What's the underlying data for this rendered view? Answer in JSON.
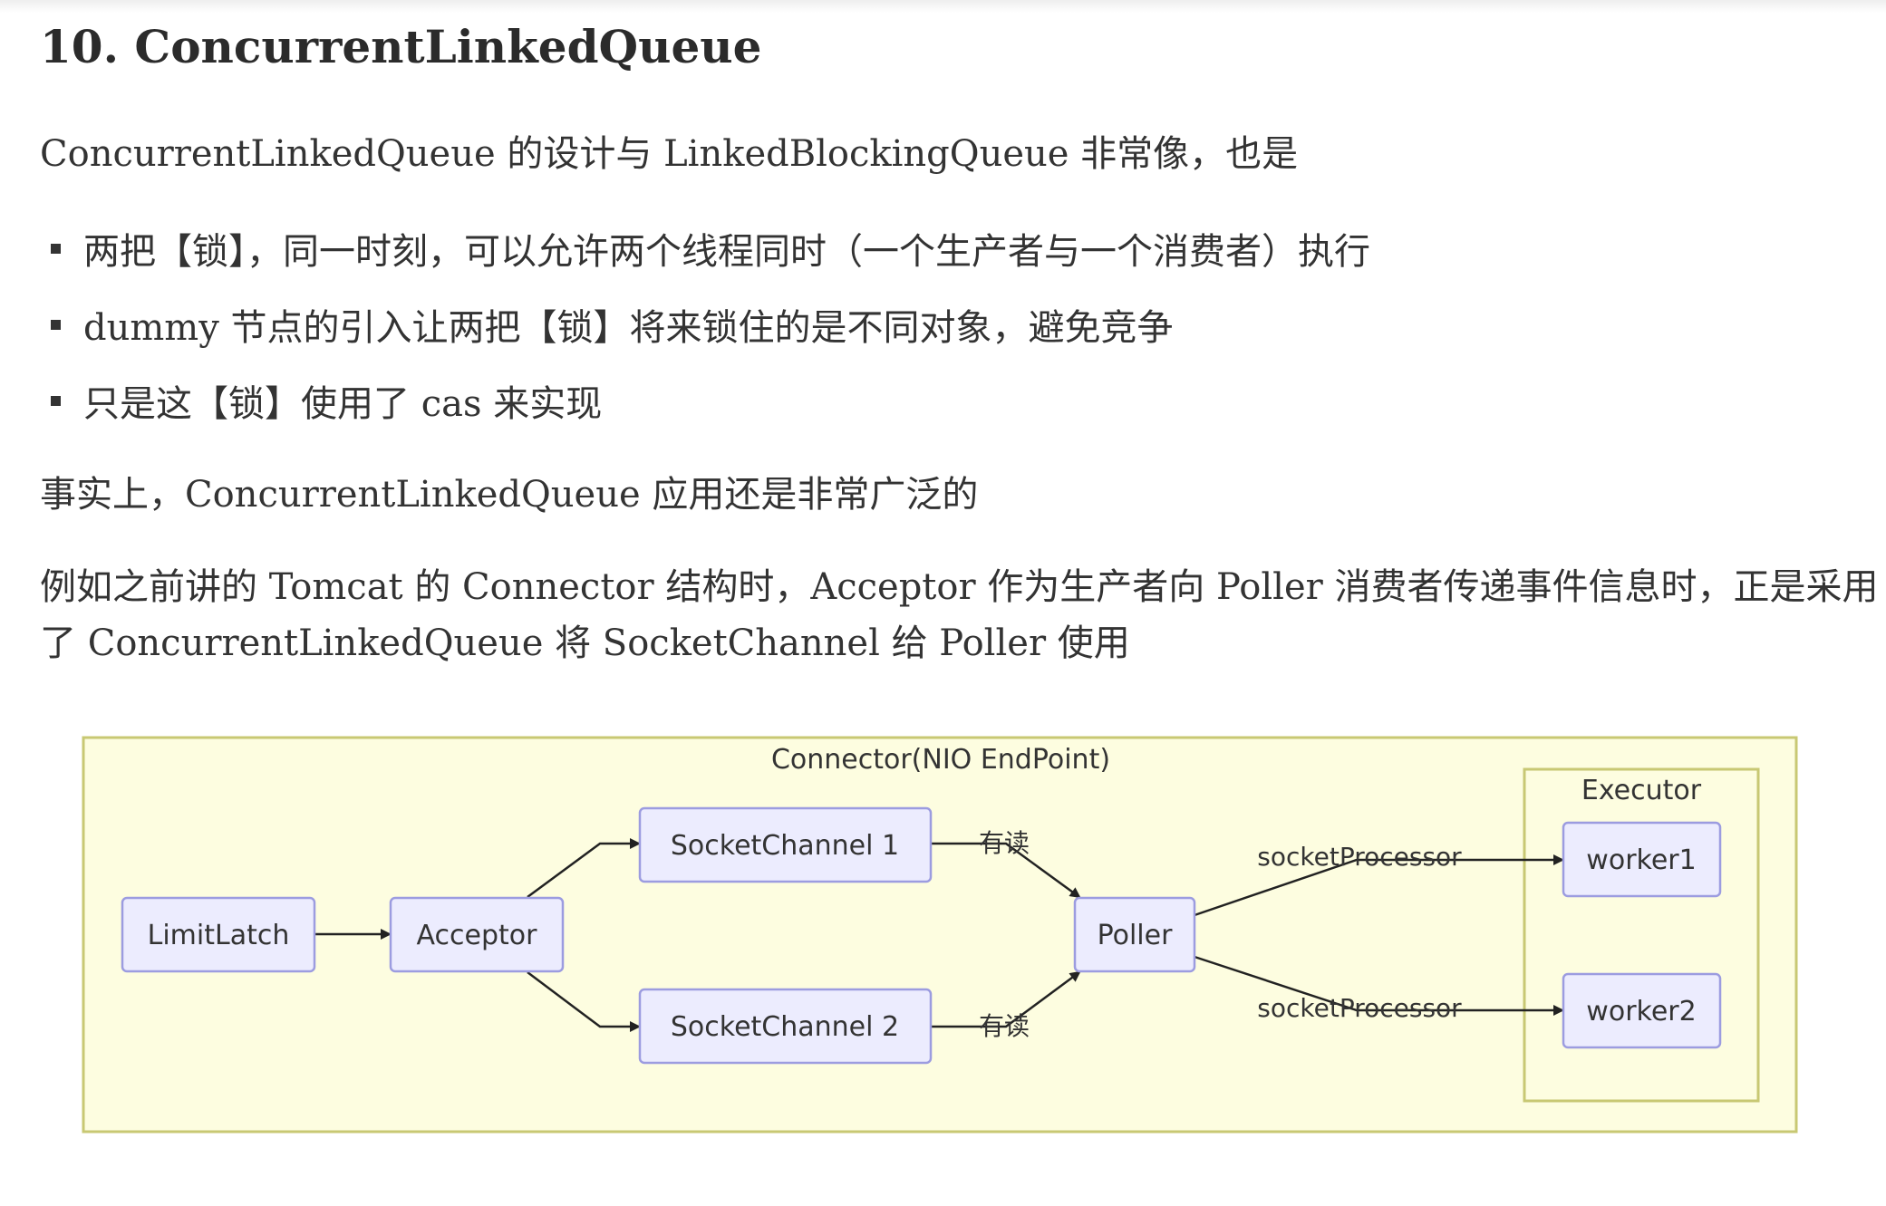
{
  "heading": "10. ConcurrentLinkedQueue",
  "intro": "ConcurrentLinkedQueue 的设计与 LinkedBlockingQueue 非常像，也是",
  "bullets": [
    "两把【锁】，同一时刻，可以允许两个线程同时（一个生产者与一个消费者）执行",
    "dummy 节点的引入让两把【锁】将来锁住的是不同对象，避免竞争",
    "只是这【锁】使用了 cas 来实现"
  ],
  "fact": "事实上，ConcurrentLinkedQueue 应用还是非常广泛的",
  "example_line1": "例如之前讲的 Tomcat 的 Connector 结构时，Acceptor 作为生产者向 Poller 消费者传递事件信息时，正是采用",
  "example_line2": "了 ConcurrentLinkedQueue 将 SocketChannel 给 Poller 使用",
  "diagram": {
    "outer_title": "Connector(NIO EndPoint)",
    "executor_title": "Executor",
    "nodes": {
      "limitlatch": "LimitLatch",
      "acceptor": "Acceptor",
      "socketchannel1": "SocketChannel 1",
      "socketchannel2": "SocketChannel 2",
      "poller": "Poller",
      "worker1": "worker1",
      "worker2": "worker2"
    },
    "edge_labels": {
      "read1": "有读",
      "read2": "有读",
      "sp1": "socketProcessor",
      "sp2": "socketProcessor"
    },
    "colors": {
      "outer_fill": "#fdfde0",
      "outer_stroke": "#c8c873",
      "node_fill": "#ececfe",
      "node_stroke": "#9c9ce0",
      "edge": "#222222"
    }
  }
}
